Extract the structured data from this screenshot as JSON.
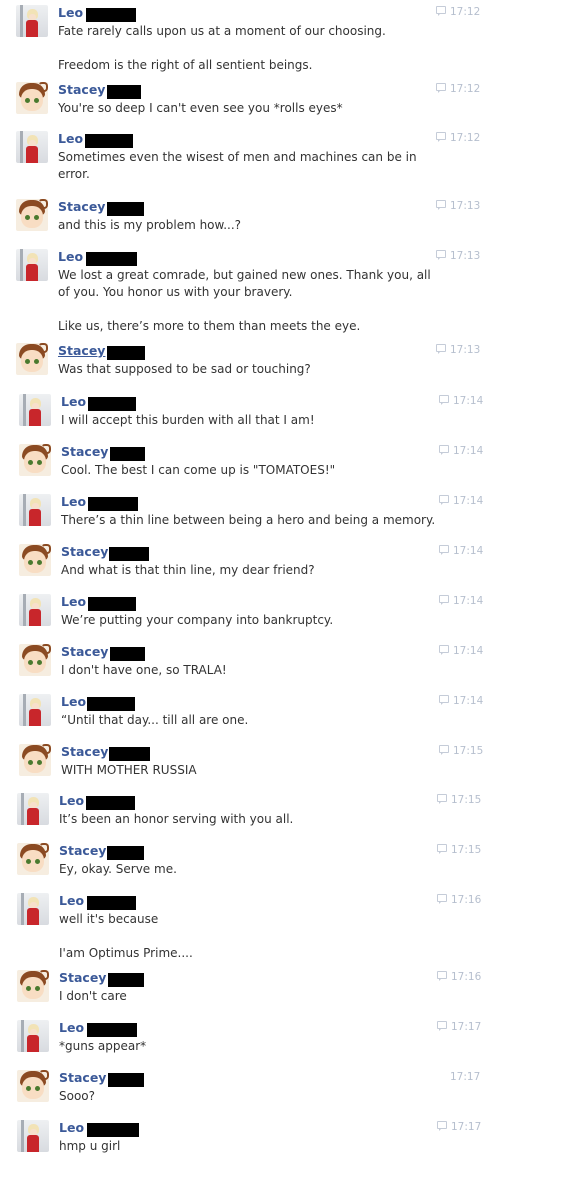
{
  "conversation": {
    "messages": [
      {
        "sender": "Leo",
        "avatar": "leo-avatar",
        "time": "17:12",
        "lines": [
          "Fate rarely calls upon us at a moment of our choosing.",
          "",
          "Freedom is the right of all sentient beings."
        ]
      },
      {
        "sender": "Stacey",
        "avatar": "stacey-avatar",
        "time": "17:12",
        "lines": [
          "You're so deep I can't even see you *rolls eyes*"
        ]
      },
      {
        "sender": "Leo",
        "avatar": "leo-avatar",
        "time": "17:12",
        "lines": [
          "Sometimes even the wisest of men and machines can be in",
          "error."
        ]
      },
      {
        "sender": "Stacey",
        "avatar": "stacey-avatar",
        "time": "17:13",
        "lines": [
          "and this is my problem how...?"
        ]
      },
      {
        "sender": "Leo",
        "avatar": "leo-avatar",
        "time": "17:13",
        "lines": [
          "We lost a great comrade, but gained new ones. Thank you, all",
          "of you. You honor us with your bravery.",
          "",
          "Like us, there’s more to them than meets the eye."
        ]
      },
      {
        "sender": "Stacey",
        "avatar": "stacey-avatar",
        "time": "17:13",
        "lines": [
          "Was that supposed to be sad or touching?"
        ]
      },
      {
        "sender": "Leo",
        "avatar": "leo-avatar",
        "time": "17:14",
        "lines": [
          "I will accept this burden with all that I am!"
        ]
      },
      {
        "sender": "Stacey",
        "avatar": "stacey-avatar",
        "time": "17:14",
        "lines": [
          "Cool. The best I can come up is \"TOMATOES!\""
        ]
      },
      {
        "sender": "Leo",
        "avatar": "leo-avatar",
        "time": "17:14",
        "lines": [
          "There’s a thin line between being a hero and being a memory."
        ]
      },
      {
        "sender": "Stacey",
        "avatar": "stacey-avatar",
        "time": "17:14",
        "lines": [
          "And what is that thin line, my dear friend?"
        ]
      },
      {
        "sender": "Leo",
        "avatar": "leo-avatar",
        "time": "17:14",
        "lines": [
          "We’re putting your company into bankruptcy."
        ]
      },
      {
        "sender": "Stacey",
        "avatar": "stacey-avatar",
        "time": "17:14",
        "lines": [
          "I don't have one, so TRALA!"
        ]
      },
      {
        "sender": "Leo",
        "avatar": "leo-avatar",
        "time": "17:14",
        "lines": [
          "“Until that day... till all are one."
        ]
      },
      {
        "sender": "Stacey",
        "avatar": "stacey-avatar",
        "time": "17:15",
        "lines": [
          "WITH MOTHER RUSSIA"
        ]
      },
      {
        "sender": "Leo",
        "avatar": "leo-avatar",
        "time": "17:15",
        "lines": [
          "It’s been an honor serving with you all."
        ]
      },
      {
        "sender": "Stacey",
        "avatar": "stacey-avatar",
        "time": "17:15",
        "lines": [
          "Ey, okay. Serve me."
        ]
      },
      {
        "sender": "Leo",
        "avatar": "leo-avatar",
        "time": "17:16",
        "lines": [
          "well it's because",
          "",
          "I'am Optimus Prime...."
        ]
      },
      {
        "sender": "Stacey",
        "avatar": "stacey-avatar",
        "time": "17:16",
        "lines": [
          "I don't care"
        ]
      },
      {
        "sender": "Leo",
        "avatar": "leo-avatar",
        "time": "17:17",
        "lines": [
          "*guns appear*"
        ]
      },
      {
        "sender": "Stacey",
        "avatar": "stacey-avatar",
        "time": "17:17",
        "lines": [
          "Sooo?"
        ]
      },
      {
        "sender": "Leo",
        "avatar": "leo-avatar",
        "time": "17:17",
        "lines": [
          "hmp u girl"
        ]
      }
    ]
  },
  "colors": {
    "sender_name": "#3b5998",
    "message_text": "#333333",
    "timestamp": "#b6bfce",
    "redaction": "#000000",
    "background": "#ffffff"
  }
}
